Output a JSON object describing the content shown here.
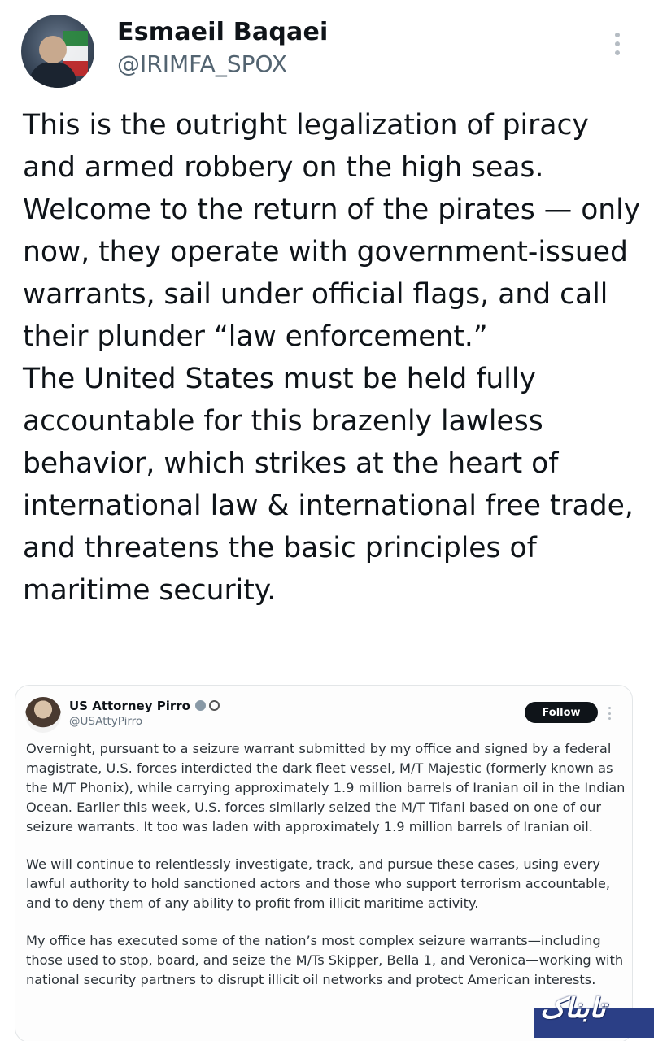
{
  "author": {
    "name": "Esmaeil Baqaei",
    "handle": "@IRIMFA_SPOX"
  },
  "tweet": {
    "paragraphs": [
      "This is the outright legalization of piracy and armed robbery on the high seas. Welcome to the return of the pirates — only now, they operate with government-issued warrants, sail under official flags, and call their plunder “law enforcement.”",
      "The United States must be held fully accountable for this brazenly lawless behavior, which strikes at the heart of international law & international free trade, and threatens the basic principles of maritime security."
    ]
  },
  "quoted": {
    "name": "US Attorney Pirro",
    "handle": "@USAttyPirro",
    "follow_label": "Follow",
    "paragraphs": [
      "Overnight, pursuant to a seizure warrant submitted by my office and signed by a federal magistrate, U.S. forces interdicted the dark fleet vessel, M/T Majestic (formerly known as the M/T Phonix), while carrying approximately 1.9 million barrels of Iranian oil in the Indian Ocean. Earlier this week, U.S. forces similarly seized the M/T Tifani based on one of our seizure warrants. It too was laden with approximately 1.9 million barrels of Iranian oil.",
      "We will continue to relentlessly investigate, track, and pursue these cases, using every lawful authority to hold sanctioned actors and those who support terrorism accountable, and to deny them of any ability to profit from illicit maritime activity.",
      "My office has executed some of the nation’s most complex seizure warrants—including those used to stop, board, and seize the M/Ts Skipper, Bella 1, and Veronica—working with national security partners to disrupt illicit oil networks and protect American interests."
    ]
  },
  "watermark": {
    "text": "تابناک"
  }
}
